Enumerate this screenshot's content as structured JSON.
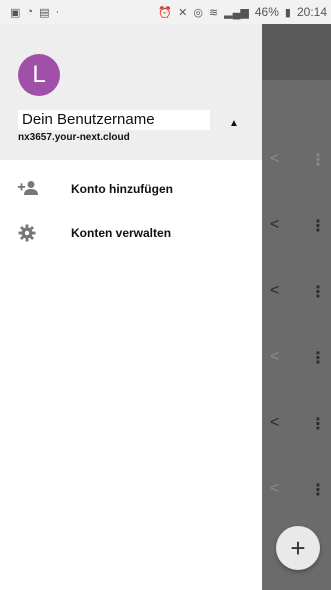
{
  "status_bar": {
    "battery": "46%",
    "time": "20:14"
  },
  "drawer": {
    "avatar_letter": "L",
    "username": "Dein Benutzername",
    "server": "nx3657.your-next.cloud",
    "menu_items": [
      {
        "label": "Konto hinzufügen",
        "icon": "add-person-icon"
      },
      {
        "label": "Konten verwalten",
        "icon": "gear-icon"
      }
    ]
  },
  "background": {
    "fab_label": "+"
  },
  "colors": {
    "avatar": "#a050a8",
    "scrim": "#6b6b6b"
  }
}
